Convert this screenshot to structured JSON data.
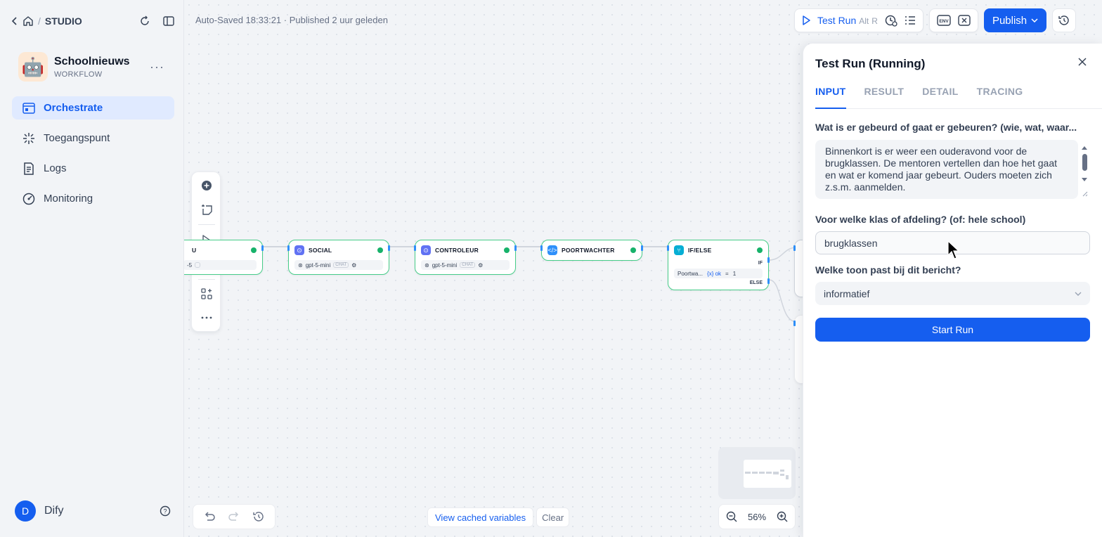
{
  "sidebar": {
    "breadcrumb": "STUDIO",
    "app": {
      "name": "Schoolnieuws",
      "type": "WORKFLOW",
      "emoji": "🤖"
    },
    "nav": [
      {
        "label": "Orchestrate",
        "icon": "orchestrate-icon",
        "active": true
      },
      {
        "label": "Toegangspunt",
        "icon": "access-point-icon"
      },
      {
        "label": "Logs",
        "icon": "logs-icon"
      },
      {
        "label": "Monitoring",
        "icon": "monitoring-icon"
      }
    ],
    "user": {
      "initial": "D",
      "name": "Dify"
    }
  },
  "header": {
    "status": "Auto-Saved 18:33:21 · Published 2 uur geleden",
    "test_run": "Test Run",
    "shortcut_alt": "Alt",
    "shortcut_key": "R",
    "env": "ENV",
    "publish": "Publish"
  },
  "nodes": [
    {
      "title": "",
      "model": "-5",
      "color": "#6172f3"
    },
    {
      "title": "SOCIAL",
      "model": "gpt-5-mini",
      "tag": "CHAT",
      "color": "#6172f3"
    },
    {
      "title": "CONTROLEUR",
      "model": "gpt-5-mini",
      "tag": "CHAT",
      "color": "#6172f3"
    },
    {
      "title": "POORTWACHTER",
      "color": "#2e90fa"
    },
    {
      "title": "IF/ELSE",
      "color": "#06aed4",
      "if_label": "IF",
      "else_label": "ELSE",
      "condition_var": "Poortwa...",
      "condition_field": "{x} ok",
      "condition_op": "=",
      "condition_val": "1"
    }
  ],
  "canvas_footer": {
    "view_cached": "View cached variables",
    "clear": "Clear",
    "zoom": "56%"
  },
  "panel": {
    "title": "Test Run (Running)",
    "tabs": [
      "INPUT",
      "RESULT",
      "DETAIL",
      "TRACING"
    ],
    "active_tab": "INPUT",
    "q1_label": "Wat is er gebeurd of gaat er gebeuren? (wie, wat, waar...",
    "q1_value": "Binnenkort is er weer een ouderavond voor de brugklassen. De mentoren vertellen dan hoe het gaat en wat er komend jaar gebeurt. Ouders moeten zich z.s.m. aanmelden.",
    "q2_label": "Voor welke klas of afdeling? (of: hele school)",
    "q2_value": "brugklassen",
    "q3_label": "Welke toon past bij dit bericht?",
    "q3_value": "informatief",
    "start_run": "Start Run"
  },
  "colors": {
    "accent": "#155eef",
    "node_border": "#47cd89",
    "success": "#17b26a"
  }
}
